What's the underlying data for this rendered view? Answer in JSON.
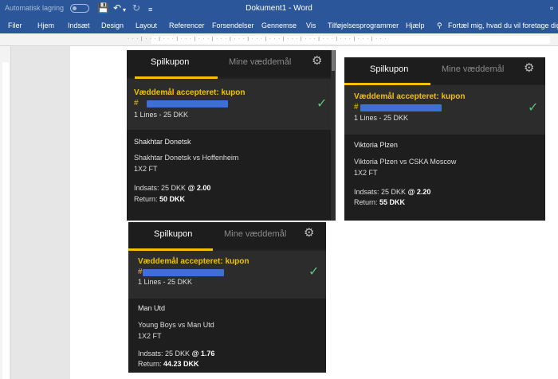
{
  "window": {
    "autosave_label": "Automatisk lagring",
    "title": "Dokument1  -  Word",
    "save_icon": "save-icon",
    "undo_icon": "undo-icon",
    "redo_icon": "redo-icon"
  },
  "ribbon": {
    "tabs": [
      "Filer",
      "Hjem",
      "Indsæt",
      "Design",
      "Layout",
      "Referencer",
      "Forsendelser",
      "Gennemse",
      "Vis",
      "Tilføjelsesprogrammer",
      "Hjælp"
    ],
    "tell_me": "Fortæl mig, hvad du vil foretage dig"
  },
  "coupons": [
    {
      "tab_active": "Spilkupon",
      "tab_inactive": "Mine væddemål",
      "accepted": "Væddemål accepteret: kupon",
      "hash": "#",
      "lines": "1 Lines - 25 DKK",
      "team": "Shakhtar Donetsk",
      "match": "Shakhtar Donetsk  vs  Hoffenheim",
      "market": "1X2 FT",
      "stake_label": "Indsats:  25 DKK",
      "odds": "@ 2.00",
      "return_label": "Return:",
      "return_value": "50 DKK"
    },
    {
      "tab_active": "Spilkupon",
      "tab_inactive": "Mine væddemål",
      "accepted": "Væddemål accepteret: kupon",
      "hash": "#",
      "lines": "1 Lines - 25 DKK",
      "team": "Viktoria Plzen",
      "match": "Viktoria Plzen  vs  CSKA Moscow",
      "market": "1X2 FT",
      "stake_label": "Indsats:  25 DKK",
      "odds": "@ 2.20",
      "return_label": "Return:",
      "return_value": "55 DKK"
    },
    {
      "tab_active": "Spilkupon",
      "tab_inactive": "Mine væddemål",
      "accepted": "Væddemål accepteret: kupon",
      "hash": "#",
      "lines": "1 Lines - 25 DKK",
      "team": "Man Utd",
      "match": "Young Boys  vs  Man Utd",
      "market": "1X2 FT",
      "stake_label": "Indsats:  25 DKK",
      "odds": "@ 1.76",
      "return_label": "Return:",
      "return_value": "44.23 DKK"
    }
  ],
  "colors": {
    "word_blue": "#2b579a",
    "coupon_bg": "#222222",
    "accent_yellow": "#f2c100",
    "redaction_blue": "#3d6fd6",
    "check_green": "#5ec27a"
  }
}
